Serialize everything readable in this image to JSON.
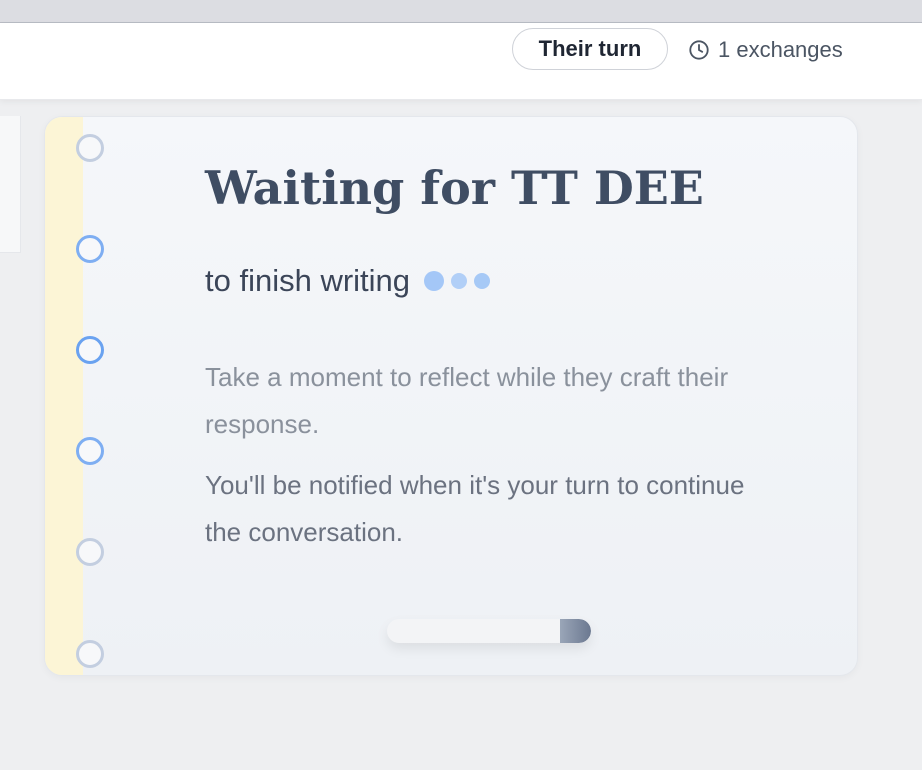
{
  "header": {
    "turn_badge": "Their turn",
    "exchange_count": "1 exchanges",
    "clock_icon": "clock-icon"
  },
  "card": {
    "title": "Waiting for TT DEE",
    "subtitle": "to finish writing",
    "message_line1": "Take a moment to reflect while they craft their response.",
    "message_line2": "You'll be notified when it's your turn to continue the conversation.",
    "progress_fraction": 0.15
  },
  "colors": {
    "accent_blue": "#6aa2f0",
    "margin_stripe": "#fcf5d6",
    "title_color": "#3f4d63"
  }
}
